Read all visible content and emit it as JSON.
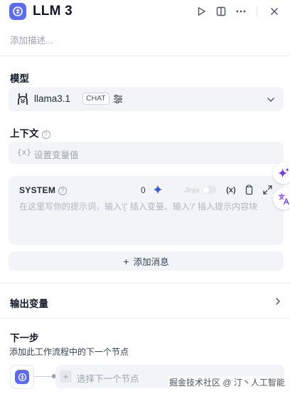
{
  "header": {
    "title": "LLM 3",
    "icon": "llm-node-icon",
    "accent_color": "#5b6cf0",
    "actions": [
      "play-icon",
      "split-view-icon",
      "more-icon",
      "close-icon"
    ]
  },
  "description_placeholder": "添加描述...",
  "model": {
    "section_label": "模型",
    "name": "llama3.1",
    "badge": "CHAT"
  },
  "context": {
    "section_label": "上下文",
    "var_icon_text": "{x}",
    "placeholder": "设置变量值"
  },
  "system": {
    "label": "SYSTEM",
    "token_count": "0",
    "jinja_label": "Jinja",
    "jinja_enabled": false,
    "var_button_text": "(x)",
    "placeholder": "在这里写你的提示词，输入'{' 插入变量、输入'/' 插入提示内容块"
  },
  "add_message_label": "添加消息",
  "output": {
    "section_label": "输出变量"
  },
  "next_step": {
    "section_label": "下一步",
    "hint": "添加此工作流程中的下一个节点",
    "select_label": "选择下一个节点"
  },
  "watermark": "掘金技术社区 @ 汀丶人工智能"
}
